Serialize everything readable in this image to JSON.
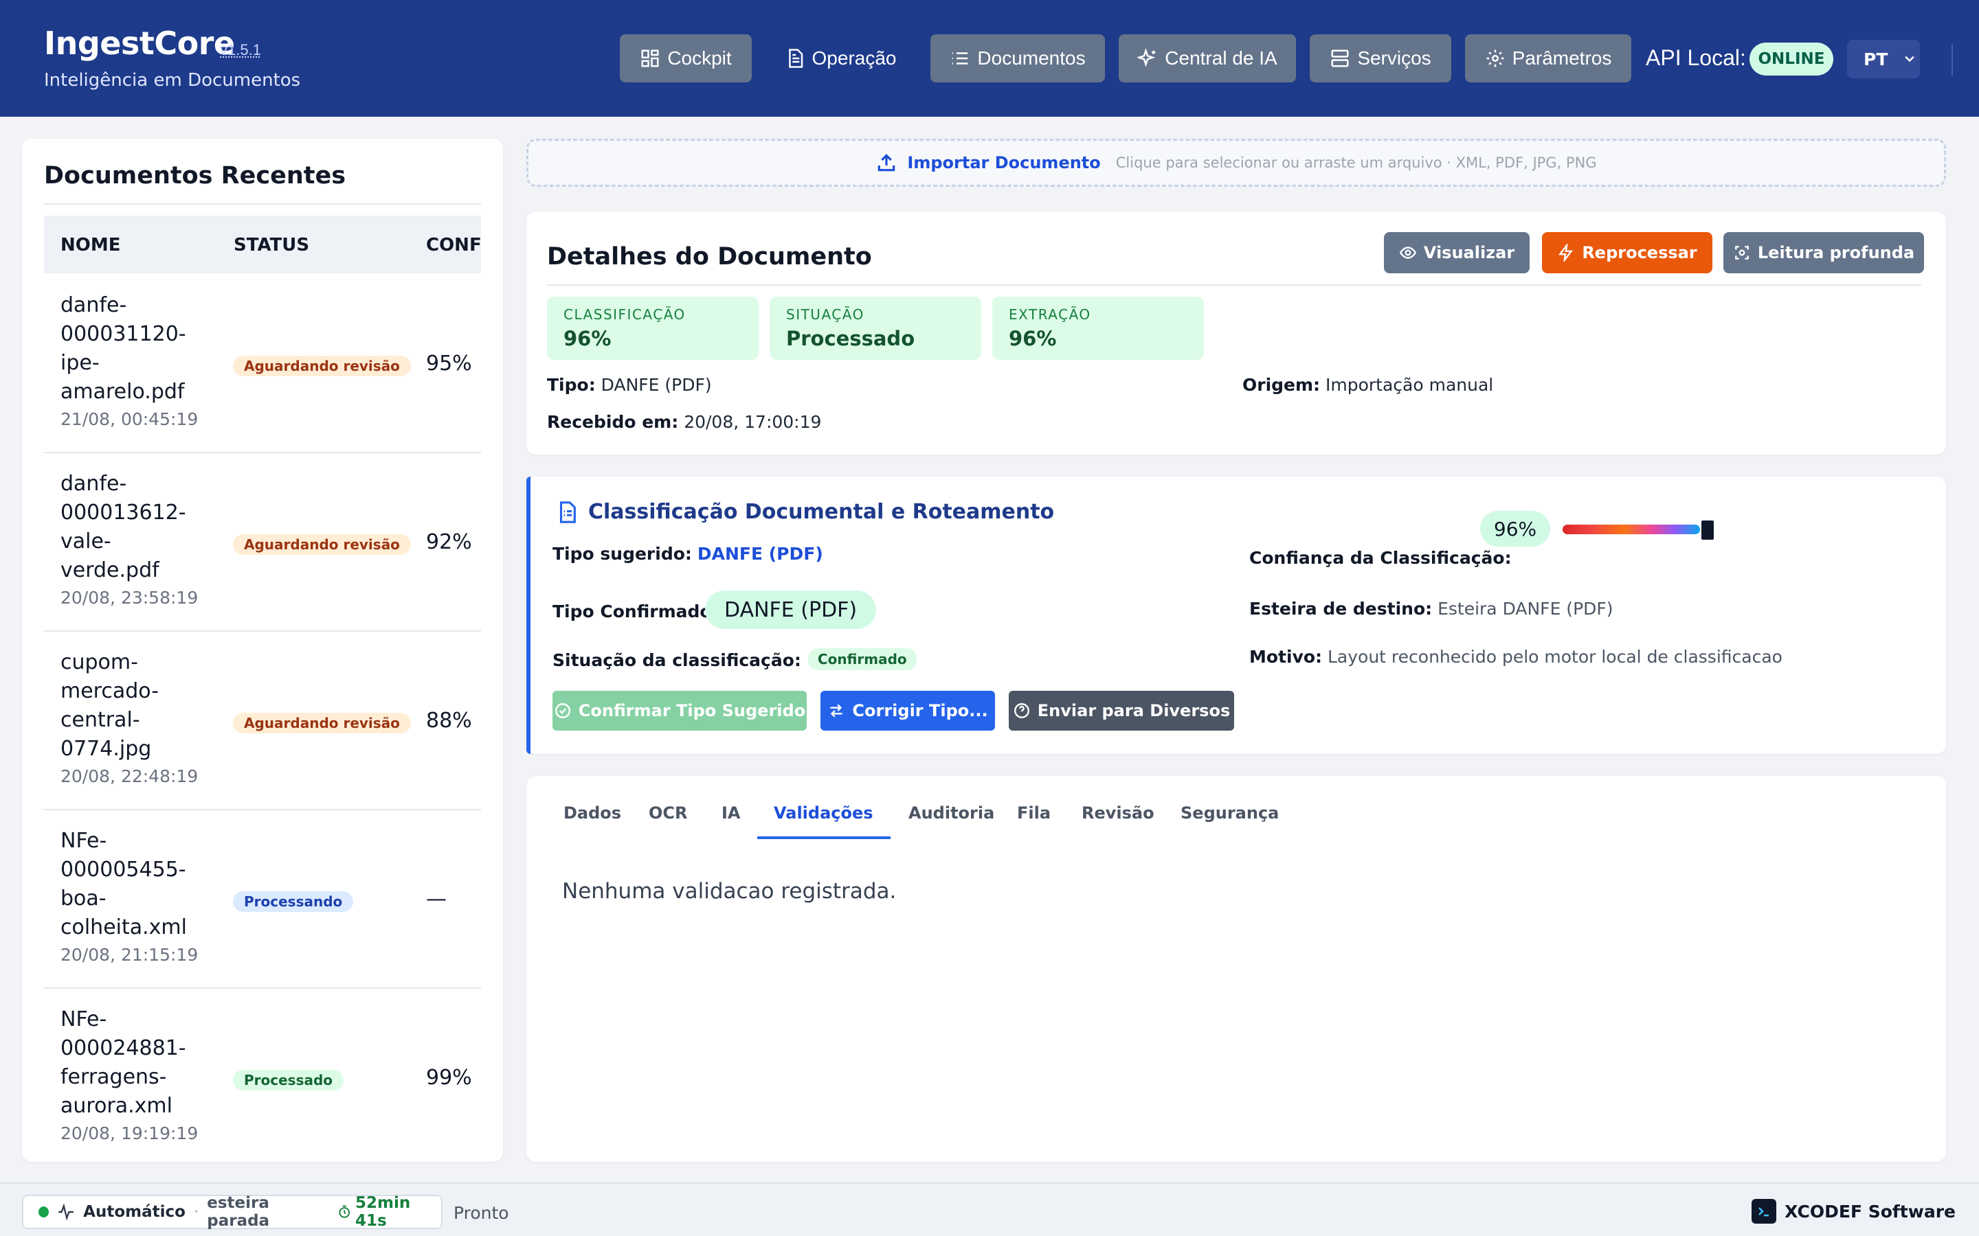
{
  "header": {
    "app_name": "IngestCore",
    "version": "v1.5.1",
    "subtitle": "Inteligência em Documentos",
    "nav": [
      {
        "label": "Cockpit",
        "icon": "dashboard-icon"
      },
      {
        "label": "Operação",
        "icon": "document-icon"
      },
      {
        "label": "Documentos",
        "icon": "list-icon"
      },
      {
        "label": "Central de IA",
        "icon": "sparkles-icon"
      },
      {
        "label": "Serviços",
        "icon": "server-icon"
      },
      {
        "label": "Parâmetros",
        "icon": "gear-icon"
      }
    ],
    "api_label": "API Local:",
    "api_status": "ONLINE",
    "language": "PT"
  },
  "sidebar": {
    "title": "Documentos Recentes",
    "columns": [
      "NOME",
      "STATUS",
      "CONFI"
    ],
    "rows": [
      {
        "name_lines": [
          "danfe-",
          "000031120-",
          "ipe-",
          "amarelo.pdf"
        ],
        "time": "21/08, 00:45:19",
        "status": "Aguardando revisão",
        "status_kind": "wait",
        "confidence": "95%"
      },
      {
        "name_lines": [
          "danfe-",
          "000013612-",
          "vale-",
          "verde.pdf"
        ],
        "time": "20/08, 23:58:19",
        "status": "Aguardando revisão",
        "status_kind": "wait",
        "confidence": "92%"
      },
      {
        "name_lines": [
          "cupom-",
          "mercado-",
          "central-",
          "0774.jpg"
        ],
        "time": "20/08, 22:48:19",
        "status": "Aguardando revisão",
        "status_kind": "wait",
        "confidence": "88%"
      },
      {
        "name_lines": [
          "NFe-",
          "000005455-",
          "boa-",
          "colheita.xml"
        ],
        "time": "20/08, 21:15:19",
        "status": "Processando",
        "status_kind": "proc",
        "confidence": "—"
      },
      {
        "name_lines": [
          "NFe-",
          "000024881-",
          "ferragens-",
          "aurora.xml"
        ],
        "time": "20/08, 19:19:19",
        "status": "Processado",
        "status_kind": "done",
        "confidence": "99%"
      }
    ]
  },
  "import": {
    "label": "Importar Documento",
    "hint": "Clique para selecionar ou arraste um arquivo · XML, PDF, JPG, PNG"
  },
  "details": {
    "title": "Detalhes do Documento",
    "actions": {
      "view": "Visualizar",
      "reprocess": "Reprocessar",
      "deep_read": "Leitura profunda"
    },
    "stats": [
      {
        "label": "CLASSIFICAÇÃO",
        "value": "96%"
      },
      {
        "label": "SITUAÇÃO",
        "value": "Processado"
      },
      {
        "label": "EXTRAÇÃO",
        "value": "96%"
      }
    ],
    "tipo_label": "Tipo:",
    "tipo_value": "DANFE (PDF)",
    "origem_label": "Origem:",
    "origem_value": "Importação manual",
    "recebido_label": "Recebido em:",
    "recebido_value": "20/08, 17:00:19"
  },
  "classification": {
    "title": "Classificação Documental e Roteamento",
    "suggested_label": "Tipo sugerido:",
    "suggested_value": "DANFE (PDF)",
    "confirmed_label": "Tipo Confirmado:",
    "confirmed_value": "DANFE (PDF)",
    "situation_label": "Situação da classificação:",
    "situation_value": "Confirmado",
    "confidence_label": "Confiança da Classificação:",
    "confidence_value": "96%",
    "confidence_fraction": 0.96,
    "pipeline_label": "Esteira de destino:",
    "pipeline_value": "Esteira DANFE (PDF)",
    "reason_label": "Motivo:",
    "reason_value": "Layout reconhecido pelo motor local de classificacao",
    "buttons": {
      "confirm": "Confirmar Tipo Sugerido",
      "correct": "Corrigir Tipo...",
      "send": "Enviar para Diversos"
    }
  },
  "tabs": {
    "items": [
      "Dados",
      "OCR",
      "IA",
      "Validações",
      "Auditoria",
      "Fila",
      "Revisão",
      "Segurança"
    ],
    "active": "Validações",
    "empty_message": "Nenhuma validacao registrada."
  },
  "footer": {
    "mode": "Automático",
    "separator": "·",
    "pipeline_state": "esteira parada",
    "timer": "52min 41s",
    "ready": "Pronto",
    "vendor": "XCODEF Software"
  },
  "colors": {
    "header_bg": "#1e3a8a",
    "accent": "#2563eb",
    "reprocess": "#ea580c",
    "success_bg": "#dcfce7"
  }
}
